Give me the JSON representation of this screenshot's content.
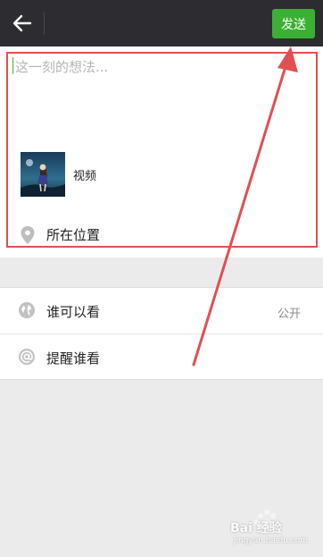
{
  "header": {
    "send_label": "发送"
  },
  "compose": {
    "placeholder": "这一刻的想法...",
    "video_label": "视频",
    "location_label": "所在位置"
  },
  "settings": {
    "items": [
      {
        "label": "谁可以看",
        "value": "公开",
        "icon": "globe-icon"
      },
      {
        "label": "提醒谁看",
        "icon": "at-icon"
      }
    ]
  },
  "watermark": {
    "text": "Bai 经验",
    "url": "jingyan.baidu.com"
  },
  "colors": {
    "topbar": "#2d2d31",
    "accent_green": "#3cb034",
    "annotation_red": "#e05050",
    "background": "#ebebeb"
  }
}
